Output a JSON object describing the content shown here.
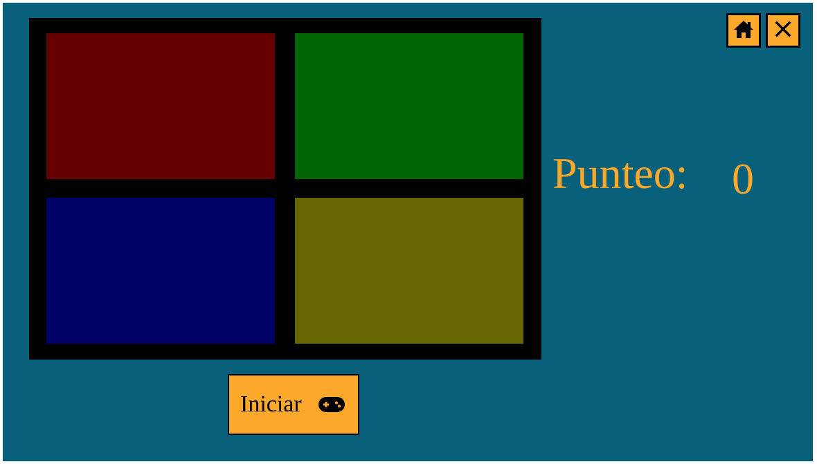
{
  "colors": {
    "background": "#08607a",
    "board": "#000000",
    "accent": "#fca92b",
    "pad_red": "#660000",
    "pad_green": "#006400",
    "pad_blue": "#000066",
    "pad_yellow": "#666600"
  },
  "board": {
    "pads": [
      {
        "color_name": "red"
      },
      {
        "color_name": "green"
      },
      {
        "color_name": "blue"
      },
      {
        "color_name": "yellow"
      }
    ]
  },
  "header": {
    "home_icon": "home-icon",
    "close_icon": "close-icon"
  },
  "score": {
    "label": "Punteo:",
    "value": "0"
  },
  "start_button": {
    "label": "Iniciar",
    "icon": "gamepad-icon"
  }
}
